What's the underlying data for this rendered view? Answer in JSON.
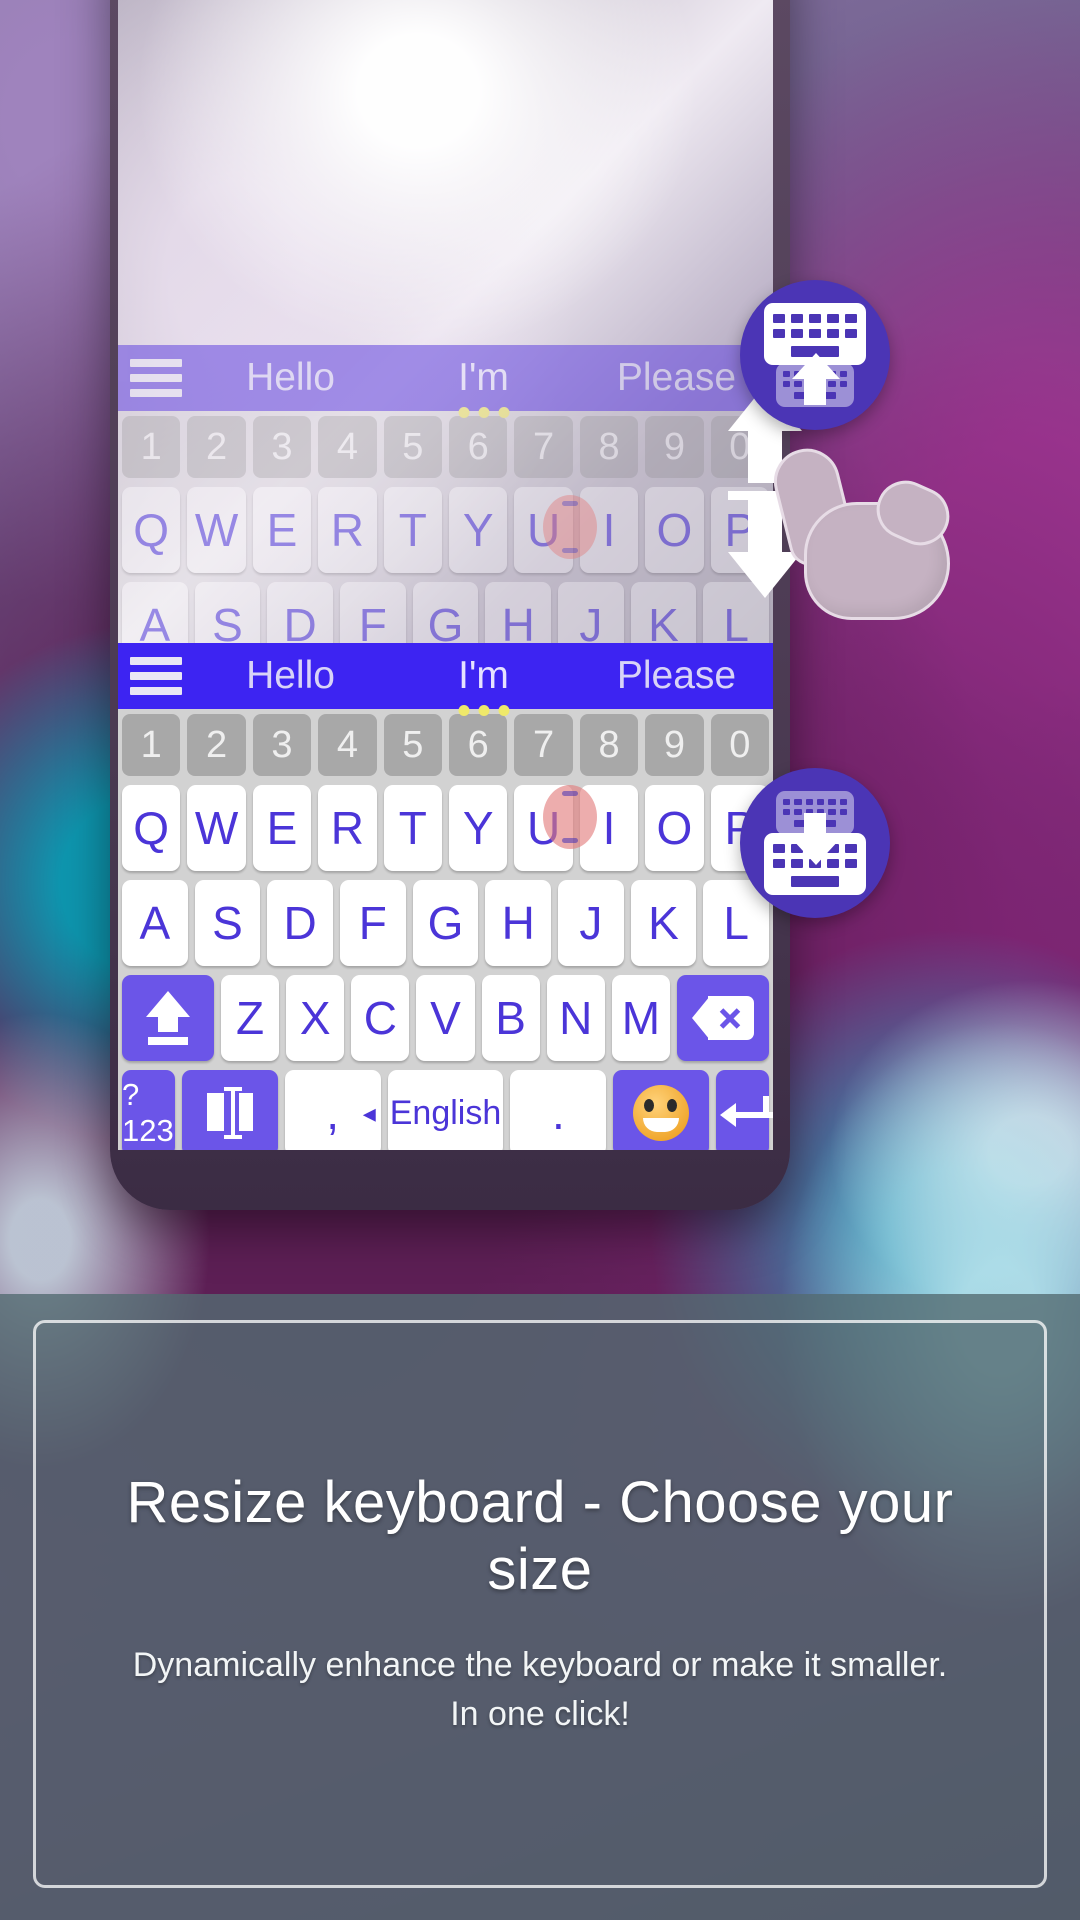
{
  "app": {
    "accent_purple": "#4b35b5",
    "suggestion_bar_blue": "#3d24f2",
    "key_text_color": "#4b35d8"
  },
  "keyboard": {
    "menu_icon": "hamburger-menu-icon",
    "suggestions": [
      "Hello",
      "I'm",
      "Please"
    ],
    "number_row": [
      "1",
      "2",
      "3",
      "4",
      "5",
      "6",
      "7",
      "8",
      "9",
      "0"
    ],
    "row_top": [
      "Q",
      "W",
      "E",
      "R",
      "T",
      "Y",
      "U",
      "I",
      "O",
      "P"
    ],
    "row_home": [
      "A",
      "S",
      "D",
      "F",
      "G",
      "H",
      "J",
      "K",
      "L"
    ],
    "row_bottom": [
      "Z",
      "X",
      "C",
      "V",
      "B",
      "N",
      "M"
    ],
    "shift_key": "shift-icon",
    "backspace_key": "backspace-icon",
    "symbols_key": "?123",
    "cursor_key": "cursor-control-icon",
    "comma_key": ",",
    "period_key": ".",
    "space_key_label": "English",
    "space_prev_arrow": "◂",
    "space_next_arrow": "▸",
    "emoji_key": "emoji-smiley-icon",
    "enter_key": "enter-icon"
  },
  "floating_buttons": {
    "enlarge": {
      "name": "enlarge-keyboard-button",
      "icon": "keyboard-up-arrow-icon"
    },
    "shrink": {
      "name": "shrink-keyboard-button",
      "icon": "keyboard-down-arrow-icon"
    }
  },
  "gesture": {
    "up_arrow": "arrow-up-icon",
    "down_arrow": "arrow-down-icon",
    "hand": "hand-pointer-icon"
  },
  "caption": {
    "title": "Resize keyboard - Choose your size",
    "line1": "Dynamically enhance the keyboard or make it smaller.",
    "line2": "In one click!"
  }
}
